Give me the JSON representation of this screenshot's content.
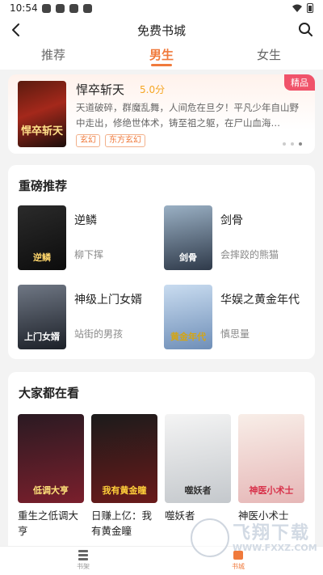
{
  "status": {
    "time": "10:54"
  },
  "header": {
    "title": "免费书城"
  },
  "tabs": [
    {
      "label": "推荐"
    },
    {
      "label": "男生"
    },
    {
      "label": "女生"
    }
  ],
  "featured": {
    "tag": "精品",
    "title": "悍卒斩天",
    "score": "5.0分",
    "description": "天道破碎，群魔乱舞，人间危在旦夕！平凡少年自山野中走出，修绝世体术，铸至祖之躯，在尸山血海…",
    "chips": [
      "玄幻",
      "东方玄幻"
    ],
    "cover_text": "悍卒斩天"
  },
  "recommend": {
    "header": "重磅推荐",
    "books": [
      {
        "title": "逆鳞",
        "author": "柳下挥",
        "cover_text": "逆鳞"
      },
      {
        "title": "剑骨",
        "author": "会摔跤的熊猫",
        "cover_text": "剑骨"
      },
      {
        "title": "神级上门女婿",
        "author": "站街的男孩",
        "cover_text": "上门女婿"
      },
      {
        "title": "华娱之黄金年代",
        "author": "慎思量",
        "cover_text": "黄金年代"
      }
    ]
  },
  "watching": {
    "header": "大家都在看",
    "books": [
      {
        "title": "重生之低调大亨",
        "cover_text": "低调大亨"
      },
      {
        "title": "日赚上亿：我有黄金瞳",
        "cover_text": "我有黄金瞳"
      },
      {
        "title": "噬妖者",
        "cover_text": "噬妖者"
      },
      {
        "title": "神医小术士",
        "cover_text": "神医小术士"
      }
    ]
  },
  "bottom_nav": [
    {
      "label": "书架"
    },
    {
      "label": "书城"
    }
  ],
  "watermark": {
    "text": "飞翔下载",
    "url": "WWW.FXXZ.COM"
  },
  "colors": {
    "accent": "#f07a3c",
    "tag": "#f0536a",
    "score": "#f5a623"
  }
}
